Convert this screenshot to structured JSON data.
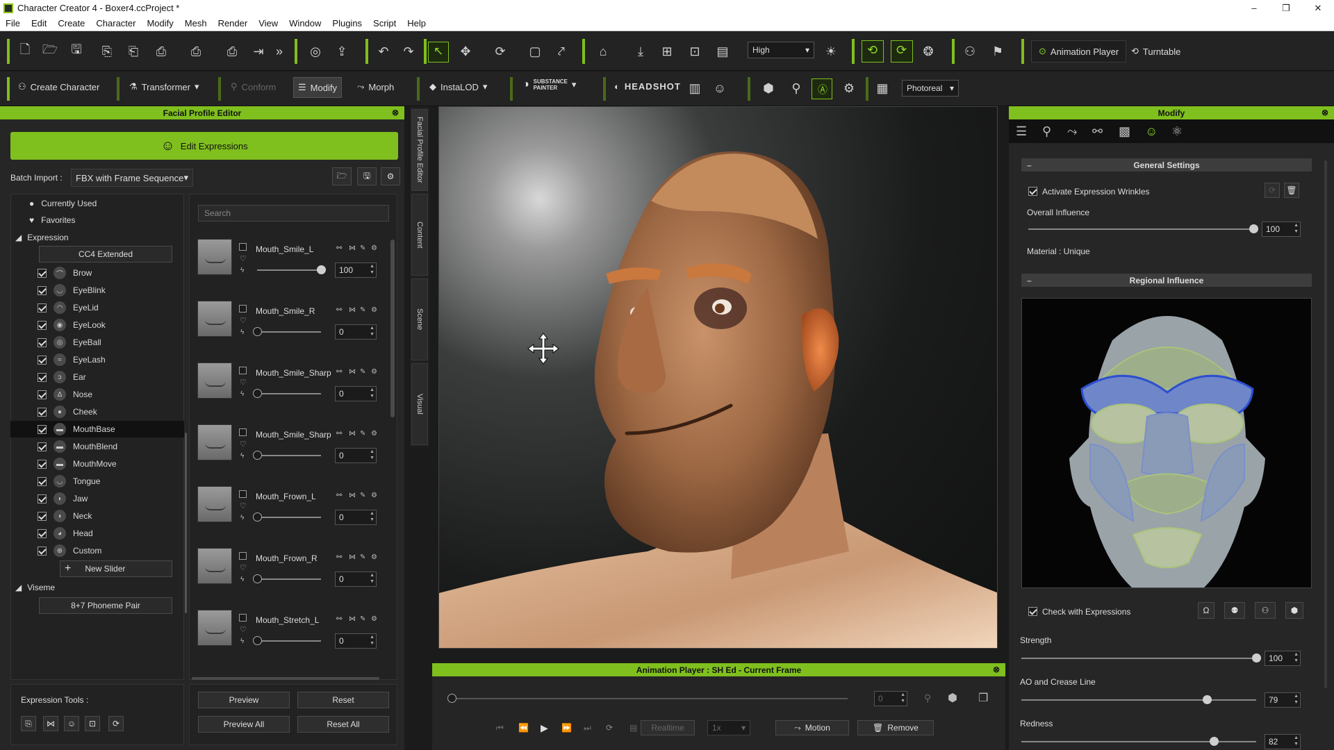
{
  "window": {
    "title": "Character Creator 4 - Boxer4.ccProject *",
    "min": "–",
    "max": "❐",
    "close": "✕"
  },
  "menu": [
    "File",
    "Edit",
    "Create",
    "Character",
    "Modify",
    "Mesh",
    "Render",
    "View",
    "Window",
    "Plugins",
    "Script",
    "Help"
  ],
  "toolbar1": {
    "quality": "High",
    "animation_player": "Animation Player",
    "turntable": "Turntable"
  },
  "toolbar2": {
    "create_character": "Create Character",
    "transformer": "Transformer",
    "conform": "Conform",
    "modify": "Modify",
    "morph": "Morph",
    "instalod": "InstaLOD",
    "substance_top": "SUBSTANCE",
    "substance_bottom": "PAINTER",
    "headshot": "HEADSHOT",
    "render_mode": "Photoreal"
  },
  "facial_editor": {
    "title": "Facial Profile Editor",
    "edit_expressions": "Edit Expressions",
    "batch_import_label": "Batch Import :",
    "batch_import_value": "FBX with Frame Sequence",
    "currently_used": "Currently Used",
    "favorites": "Favorites",
    "expression_group": "Expression",
    "cc4_extended": "CC4 Extended",
    "categories": [
      "Brow",
      "EyeBlink",
      "EyeLid",
      "EyeLook",
      "EyeBall",
      "EyeLash",
      "Ear",
      "Nose",
      "Cheek",
      "MouthBase",
      "MouthBlend",
      "MouthMove",
      "Tongue",
      "Jaw",
      "Neck",
      "Head",
      "Custom"
    ],
    "selected_category": "MouthBase",
    "new_slider": "New Slider",
    "viseme_group": "Viseme",
    "phoneme_pair": "8+7 Phoneme Pair",
    "search_placeholder": "Search",
    "morphs": [
      {
        "name": "Mouth_Smile_L",
        "value": 100,
        "level": 1.0
      },
      {
        "name": "Mouth_Smile_R",
        "value": 0,
        "level": 0.0
      },
      {
        "name": "Mouth_Smile_Sharp",
        "value": 0,
        "level": 0.0
      },
      {
        "name": "Mouth_Smile_Sharp",
        "value": 0,
        "level": 0.0
      },
      {
        "name": "Mouth_Frown_L",
        "value": 0,
        "level": 0.0
      },
      {
        "name": "Mouth_Frown_R",
        "value": 0,
        "level": 0.0
      },
      {
        "name": "Mouth_Stretch_L",
        "value": 0,
        "level": 0.0
      }
    ],
    "expression_tools": "Expression Tools :",
    "preview": "Preview",
    "reset": "Reset",
    "preview_all": "Preview All",
    "reset_all": "Reset All"
  },
  "side_tabs": [
    "Facial Profile Editor",
    "Content",
    "Scene",
    "Visual"
  ],
  "animation_player": {
    "title": "Animation Player : SH Ed - Current Frame",
    "frame": "0",
    "realtime": "Realtime",
    "speed": "1x",
    "motion": "Motion",
    "remove": "Remove"
  },
  "modify_panel": {
    "title": "Modify",
    "general_settings": "General Settings",
    "activate_wrinkles": "Activate Expression Wrinkles",
    "overall_influence": "Overall Influence",
    "overall_value": "100",
    "overall_level": 1.0,
    "material": "Material : Unique",
    "regional_influence": "Regional Influence",
    "check_with_expressions": "Check with Expressions",
    "sliders": [
      {
        "label": "Strength",
        "value": "100",
        "level": 1.0
      },
      {
        "label": "AO and Crease Line",
        "value": "79",
        "level": 0.79
      },
      {
        "label": "Redness",
        "value": "82",
        "level": 0.82
      }
    ]
  },
  "colors": {
    "accent": "#7fbf1e",
    "panel": "#262626",
    "toolbar": "#232323"
  }
}
